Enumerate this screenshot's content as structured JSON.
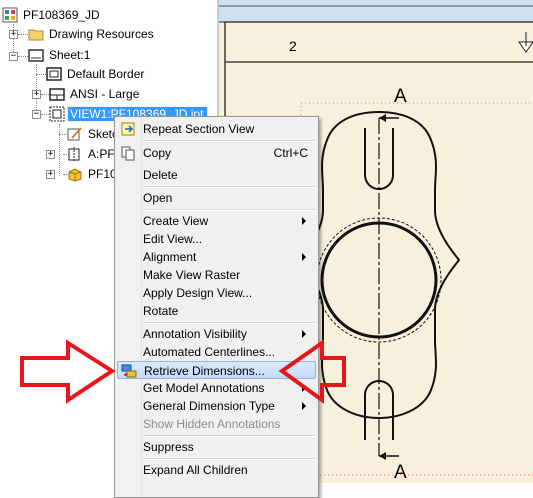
{
  "tree": {
    "root": "PF108369_JD",
    "drawing_resources": "Drawing Resources",
    "sheet": "Sheet:1",
    "default_border": "Default Border",
    "ansi": "ANSI - Large",
    "view": "VIEW1:PF108369_JD.ipt",
    "sketch": "Sketc",
    "section": "A:PF",
    "part": "PF1083"
  },
  "drawing": {
    "zone_label": "2",
    "section_label_top": "A",
    "section_label_bottom": "A"
  },
  "menu": {
    "items": [
      {
        "label": "Repeat Section View",
        "shortcut": "",
        "submenu": false,
        "disabled": false
      },
      {
        "label": "Copy",
        "shortcut": "Ctrl+C",
        "submenu": false,
        "disabled": false
      },
      {
        "label": "Delete",
        "shortcut": "",
        "submenu": false,
        "disabled": false
      },
      {
        "label": "Open",
        "shortcut": "",
        "submenu": false,
        "disabled": false
      },
      {
        "label": "Create View",
        "shortcut": "",
        "submenu": true,
        "disabled": false
      },
      {
        "label": "Edit View...",
        "shortcut": "",
        "submenu": false,
        "disabled": false
      },
      {
        "label": "Alignment",
        "shortcut": "",
        "submenu": true,
        "disabled": false
      },
      {
        "label": "Make View Raster",
        "shortcut": "",
        "submenu": false,
        "disabled": false
      },
      {
        "label": "Apply Design View...",
        "shortcut": "",
        "submenu": false,
        "disabled": false
      },
      {
        "label": "Rotate",
        "shortcut": "",
        "submenu": false,
        "disabled": false
      },
      {
        "label": "Annotation Visibility",
        "shortcut": "",
        "submenu": true,
        "disabled": false
      },
      {
        "label": "Automated Centerlines...",
        "shortcut": "",
        "submenu": false,
        "disabled": false
      },
      {
        "label": "Retrieve Dimensions...",
        "shortcut": "",
        "submenu": false,
        "disabled": false,
        "highlighted": true
      },
      {
        "label": "Get Model Annotations",
        "shortcut": "",
        "submenu": true,
        "disabled": false
      },
      {
        "label": "General Dimension Type",
        "shortcut": "",
        "submenu": true,
        "disabled": false
      },
      {
        "label": "Show Hidden Annotations",
        "shortcut": "",
        "submenu": false,
        "disabled": true
      },
      {
        "label": "Suppress",
        "shortcut": "",
        "submenu": false,
        "disabled": false
      },
      {
        "label": "Expand All Children",
        "shortcut": "",
        "submenu": false,
        "disabled": false
      }
    ]
  },
  "colors": {
    "selection": "#3399ff",
    "annotation_arrow": "#ff0000",
    "menu_highlight": "#c4daf6"
  }
}
